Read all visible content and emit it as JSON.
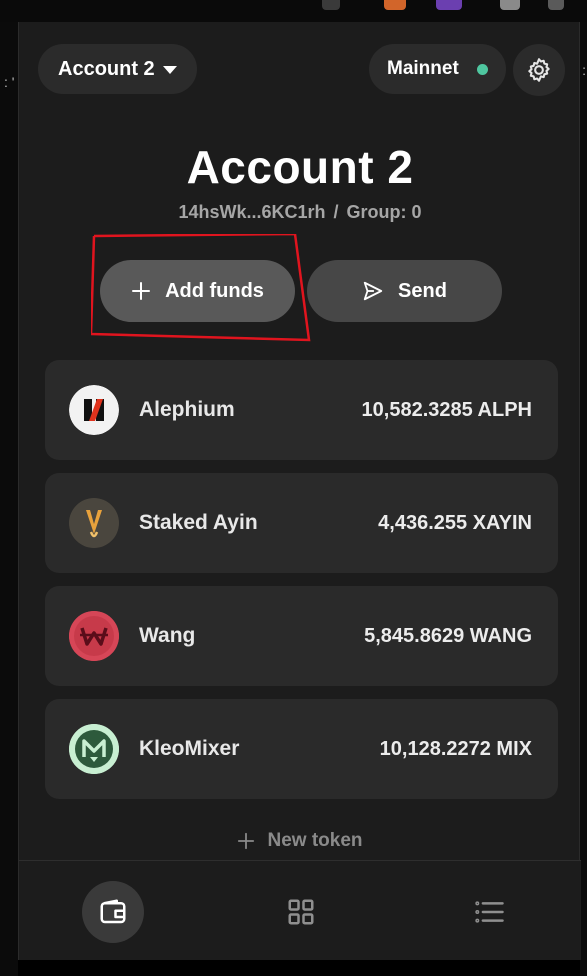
{
  "header": {
    "account_selector_label": "Account 2",
    "network_label": "Mainnet",
    "network_status_color": "#4fc7a0"
  },
  "account": {
    "name": "Account 2",
    "address_short": "14hsWk...6KC1rh",
    "separator": "/",
    "group_label": "Group: 0"
  },
  "actions": {
    "add_funds_label": "Add funds",
    "send_label": "Send"
  },
  "tokens": [
    {
      "name": "Alephium",
      "balance": "10,582.3285 ALPH",
      "icon": "alephium-logo-icon"
    },
    {
      "name": "Staked Ayin",
      "balance": "4,436.255 XAYIN",
      "icon": "staked-ayin-logo-icon"
    },
    {
      "name": "Wang",
      "balance": "5,845.8629 WANG",
      "icon": "wang-logo-icon"
    },
    {
      "name": "KleoMixer",
      "balance": "10,128.2272 MIX",
      "icon": "kleomixer-logo-icon"
    }
  ],
  "new_token_label": "New token",
  "nav": {
    "items": [
      "wallet-icon",
      "apps-grid-icon",
      "activity-list-icon"
    ]
  },
  "colors": {
    "background": "#1c1c1c",
    "card": "#2a2a2a",
    "annotation": "#e0141e"
  }
}
